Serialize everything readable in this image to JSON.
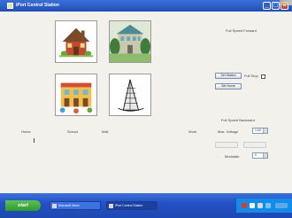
{
  "window": {
    "title": "iPort Control Station"
  },
  "panel": {
    "full_speed_forward": "Full Speed Forward",
    "full_speed_backward": "Full Speed Backward",
    "full_stop": "Full Stop",
    "set_station": "Set Station",
    "set_home": "Set Home",
    "max_voltage": "Max. Voltage",
    "max_voltage_value": "1.60",
    "modulate": "Modulate",
    "modulate_value": "0"
  },
  "labels": {
    "home": "Home",
    "school": "School",
    "mall": "Mall",
    "work": "Work"
  },
  "taskbar": {
    "start": "start",
    "tasks": [
      {
        "label": "Microsoft Word",
        "active": false
      },
      {
        "label": "iPort Control Station",
        "active": true
      }
    ]
  },
  "colors": {
    "titlebar": "#2458c8",
    "taskbar": "#2452c4",
    "start": "#3aa035",
    "tray": "#0f8de8"
  },
  "icons": [
    "house-icon",
    "school-icon",
    "mall-icon",
    "office-tower-icon"
  ]
}
